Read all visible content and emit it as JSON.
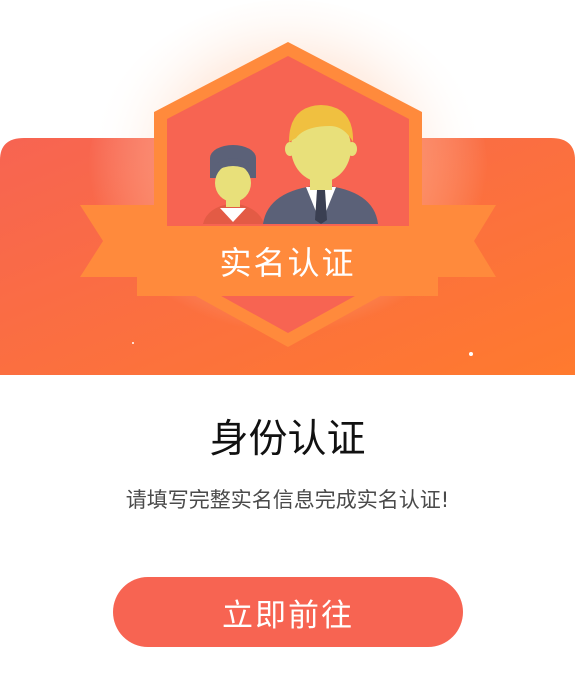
{
  "colors": {
    "banner_start": "#f76452",
    "banner_end": "#ff7a2e",
    "ribbon": "#ff8a3c",
    "shield_fill": "#f76452",
    "shield_border": "#ff8a3c",
    "button": "#f76452",
    "title": "#111111",
    "subtitle": "#4a4a4a"
  },
  "hero": {
    "badge_label": "实名认证",
    "illustration": "two-people-icon"
  },
  "content": {
    "title": "身份认证",
    "subtitle": "请填写完整实名信息完成实名认证!"
  },
  "actions": {
    "primary_label": "立即前往"
  }
}
